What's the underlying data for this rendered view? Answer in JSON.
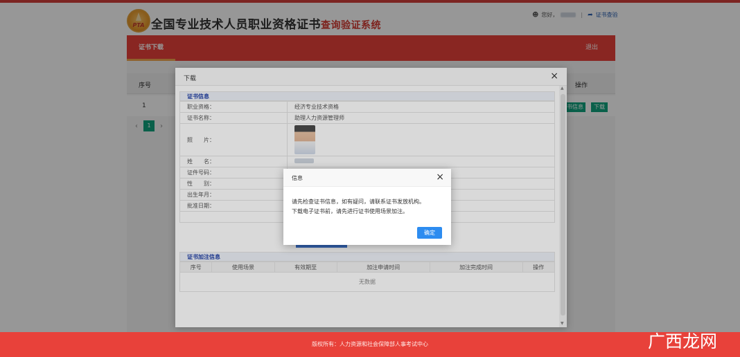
{
  "header": {
    "logo_text": "PTA",
    "title_main": "全国专业技术人员职业资格证书",
    "title_sub": "查询验证系统",
    "greeting": "您好，",
    "cert_check": "证书查验"
  },
  "nav": {
    "tab": "证书下载",
    "logout": "退出"
  },
  "table": {
    "col_num": "序号",
    "col_op": "操作",
    "row_num": "1",
    "btn_info": "书信息",
    "btn_download": "下载",
    "page_current": "1"
  },
  "download_dialog": {
    "title": "下载",
    "section_cert": "证书信息",
    "rows": [
      {
        "key": "职业资格：",
        "value": "经济专业技术资格"
      },
      {
        "key": "证书名称：",
        "value": "助理人力资源管理师"
      },
      {
        "key": "照　　片："
      },
      {
        "key": "姓　　名："
      },
      {
        "key": "证件号码："
      },
      {
        "key": "性　　别："
      },
      {
        "key": "出生年月："
      },
      {
        "key": "批准日期："
      }
    ],
    "section_endorse": "证书加注信息",
    "endorse_columns": [
      "序号",
      "使用场景",
      "有效期至",
      "加注申请时间",
      "加注完成时间",
      "操作"
    ],
    "no_data": "无数据"
  },
  "info_modal": {
    "title": "信息",
    "line1": "请先检查证书信息，如有疑问，请联系证书发放机构。",
    "line2": "下载电子证书前，请先进行证书使用场景加注。",
    "ok": "确定"
  },
  "footer": {
    "text": "版权所有：人力资源和社会保障部人事考试中心"
  },
  "watermark": "广西龙网",
  "colors": {
    "brand_red": "#e8413a",
    "accent_green": "#10a37f",
    "ok_blue": "#2d8cf0",
    "section_blue": "#1f3fa6"
  },
  "icons": {
    "user": "user-icon",
    "share": "share-arrow-icon",
    "close": "close-icon"
  }
}
